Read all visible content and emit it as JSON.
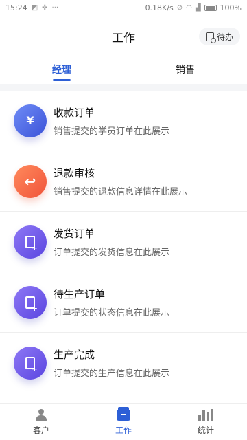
{
  "status_bar": {
    "time": "15:24",
    "network_speed": "0.18K/s",
    "battery": "100%"
  },
  "header": {
    "title": "工作",
    "todo_label": "待办"
  },
  "tabs": [
    {
      "label": "经理",
      "active": true
    },
    {
      "label": "销售",
      "active": false
    }
  ],
  "items": [
    {
      "title": "收款订单",
      "desc": "销售提交的学员订单在此展示",
      "icon": "money-refresh-icon",
      "color": "#3b52d8"
    },
    {
      "title": "退款审核",
      "desc": "销售提交的退款信息详情在此展示",
      "icon": "return-arrow-icon",
      "color": "#f0533a"
    },
    {
      "title": "发货订单",
      "desc": "订单提交的发货信息在此展示",
      "icon": "document-add-icon",
      "color": "#5a45e0"
    },
    {
      "title": "待生产订单",
      "desc": "订单提交的状态信息在此展示",
      "icon": "document-add-icon",
      "color": "#5a45e0"
    },
    {
      "title": "生产完成",
      "desc": "订单提交的生产信息在此展示",
      "icon": "document-add-icon",
      "color": "#5a45e0"
    }
  ],
  "bottom_nav": [
    {
      "label": "客户",
      "icon": "person-icon",
      "active": false
    },
    {
      "label": "工作",
      "icon": "briefcase-icon",
      "active": true
    },
    {
      "label": "统计",
      "icon": "bar-chart-icon",
      "active": false
    }
  ],
  "accent_color": "#2d5fd6"
}
